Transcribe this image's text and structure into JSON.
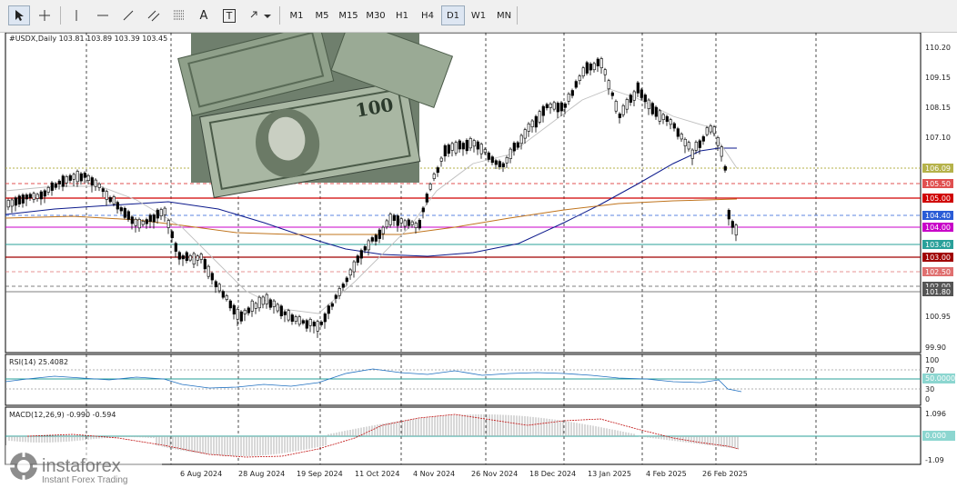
{
  "toolbar": {
    "timeframes": [
      "M1",
      "M5",
      "M15",
      "M30",
      "H1",
      "H4",
      "D1",
      "W1",
      "MN"
    ],
    "active": "D1",
    "text_tool": "A",
    "label_tool": "T"
  },
  "main_panel": {
    "header": "#USDX,Daily  103.81 103.89 103.39 103.45",
    "price_ticks": [
      "110.20",
      "109.15",
      "108.15",
      "107.10",
      "100.95",
      "99.90"
    ],
    "levels": [
      {
        "label": "106.09",
        "color": "#b5b24a"
      },
      {
        "label": "105.50",
        "color": "#e05050"
      },
      {
        "label": "105.00",
        "color": "#d00000"
      },
      {
        "label": "104.40",
        "color": "#2a5cd6"
      },
      {
        "label": "104.00",
        "color": "#c800c8"
      },
      {
        "label": "103.40",
        "color": "#2aa09a"
      },
      {
        "label": "103.00",
        "color": "#a00000"
      },
      {
        "label": "102.50",
        "color": "#e07070"
      },
      {
        "label": "102.00",
        "color": "#555555"
      },
      {
        "label": "101.80",
        "color": "#555555"
      }
    ]
  },
  "rsi_panel": {
    "header": "RSI(14) 25.4082",
    "ticks": [
      "100",
      "70",
      "30",
      "0"
    ],
    "level_tag": "50.0000"
  },
  "macd_panel": {
    "header": "MACD(12,26,9) -0.990 -0.594",
    "ticks": [
      "1.096",
      "-1.09"
    ],
    "level_tag": "0.000"
  },
  "dates": [
    "6 Aug 2024",
    "28 Aug 2024",
    "19 Sep 2024",
    "11 Oct 2024",
    "4 Nov 2024",
    "26 Nov 2024",
    "18 Dec 2024",
    "13 Jan 2025",
    "4 Feb 2025",
    "26 Feb 2025"
  ],
  "watermark": {
    "brand": "instaforex",
    "tagline": "Instant Forex Trading"
  }
}
